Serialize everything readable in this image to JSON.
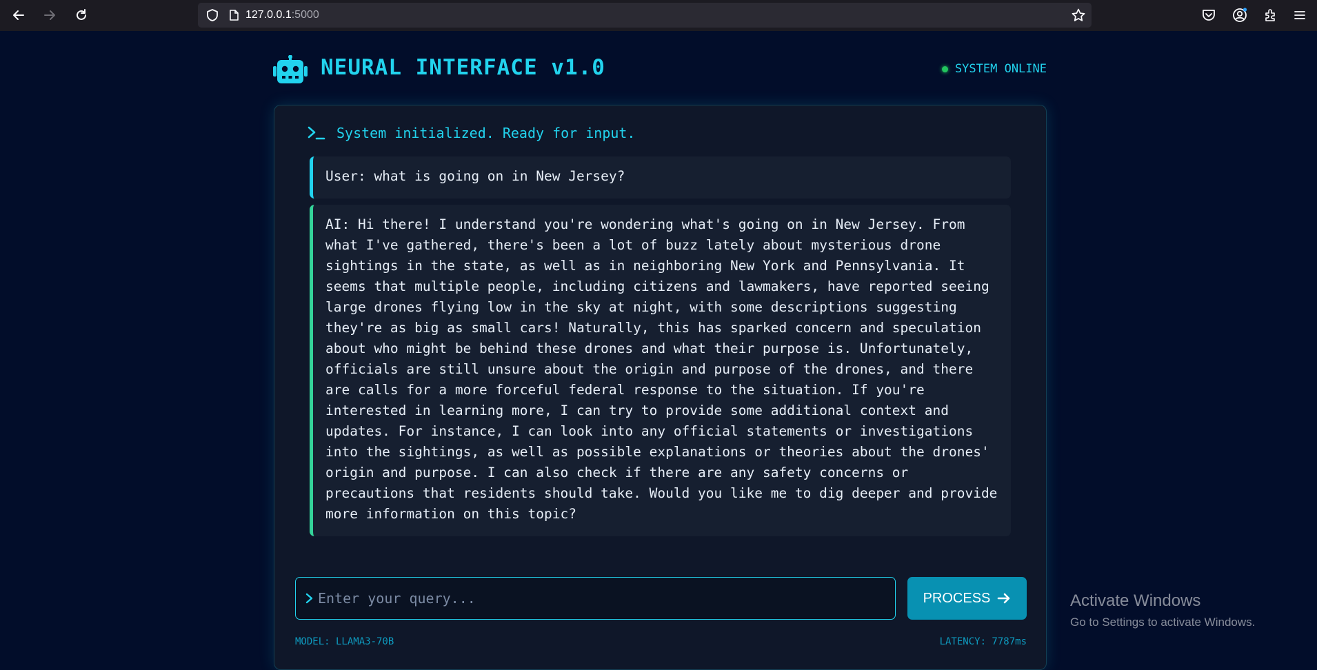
{
  "browser": {
    "url_host": "127.0.0.1",
    "url_port": ":5000"
  },
  "header": {
    "title": "NEURAL INTERFACE v1.0",
    "status": "SYSTEM ONLINE",
    "status_color": "#22c55e",
    "accent_color": "#22d3ee"
  },
  "chat": {
    "system_message": "System initialized. Ready for input.",
    "messages": [
      {
        "role": "user",
        "text": "User: what is going on in New Jersey?"
      },
      {
        "role": "ai",
        "text": "AI: Hi there! I understand you're wondering what's going on in New Jersey. From what I've gathered, there's been a lot of buzz lately about mysterious drone sightings in the state, as well as in neighboring New York and Pennsylvania. It seems that multiple people, including citizens and lawmakers, have reported seeing large drones flying low in the sky at night, with some descriptions suggesting they're as big as small cars! Naturally, this has sparked concern and speculation about who might be behind these drones and what their purpose is. Unfortunately, officials are still unsure about the origin and purpose of the drones, and there are calls for a more forceful federal response to the situation. If you're interested in learning more, I can try to provide some additional context and updates. For instance, I can look into any official statements or investigations into the sightings, as well as possible explanations or theories about the drones' origin and purpose. I can also check if there are any safety concerns or precautions that residents should take. Would you like me to dig deeper and provide more information on this topic?"
      }
    ]
  },
  "input": {
    "placeholder": "Enter your query...",
    "value": ""
  },
  "process_button": {
    "label": "PROCESS"
  },
  "footer": {
    "model": "MODEL: LLAMA3-70B",
    "latency": "LATENCY: 7787ms"
  },
  "watermark": {
    "title": "Activate Windows",
    "subtitle": "Go to Settings to activate Windows."
  }
}
